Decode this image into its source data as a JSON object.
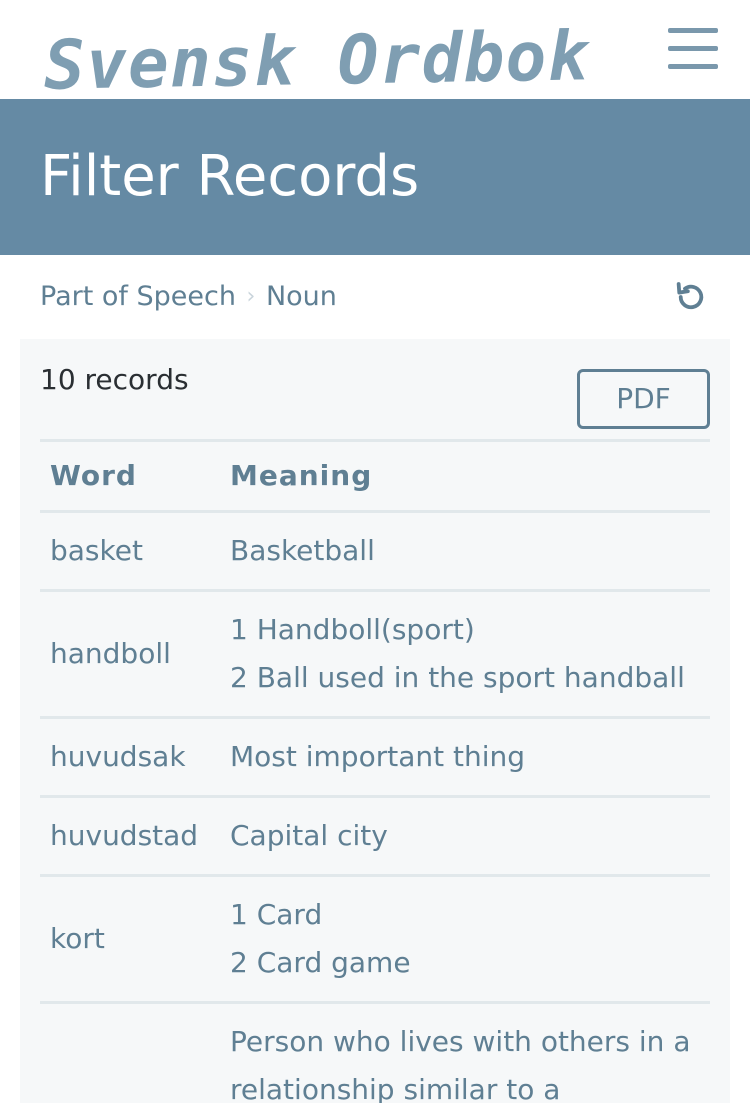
{
  "app": {
    "logo_text": "Svensk Ordbok"
  },
  "header": {
    "title": "Filter Records"
  },
  "breadcrumb": {
    "items": [
      "Part of Speech",
      "Noun"
    ]
  },
  "results": {
    "count_label": "10 records",
    "pdf_label": "PDF",
    "columns": [
      "Word",
      "Meaning"
    ],
    "rows": [
      {
        "word": "basket",
        "meanings": [
          "Basketball"
        ]
      },
      {
        "word": "handboll",
        "meanings": [
          "1 Handboll(sport)",
          "2 Ball used in the sport handball"
        ]
      },
      {
        "word": "huvudsak",
        "meanings": [
          "Most important thing"
        ]
      },
      {
        "word": "huvudstad",
        "meanings": [
          "Capital city"
        ]
      },
      {
        "word": "kort",
        "meanings": [
          "1 Card",
          "2 Card game"
        ]
      },
      {
        "word": "",
        "meanings": [
          "Person who lives with others in a relationship similar to a"
        ]
      }
    ]
  },
  "icons": {
    "menu": "hamburger-menu-icon",
    "reset": "reset-icon",
    "separator": "chevron-right-icon"
  },
  "colors": {
    "banner": "#658aa4",
    "text": "#5f7f93",
    "panel": "#f6f8f9"
  }
}
